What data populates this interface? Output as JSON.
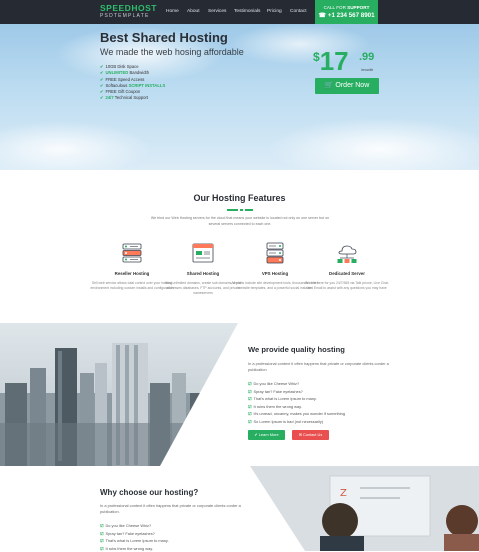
{
  "nav": {
    "logo_main": "SPEEDHOST",
    "logo_sub": "PSDTEMPLATE",
    "items": [
      "Home",
      "About",
      "Services",
      "Testimonials",
      "Pricing",
      "Contact"
    ],
    "call_label_prefix": "CALL FOR ",
    "call_label_strong": "SUPPORT",
    "call_number": "+1 234 567 8901"
  },
  "hero": {
    "title": "Best Shared Hosting",
    "subtitle": "We made the web hosing affordable",
    "features": [
      {
        "before": "",
        "strong": "",
        "after": "10GB Disk Space"
      },
      {
        "before": "",
        "strong": "UNLIMITED",
        "after": " Bandwidth"
      },
      {
        "before": "",
        "strong": "",
        "after": "FREE Speed Access"
      },
      {
        "before": "Softaculous ",
        "strong": "SCRIPT INSTALLS",
        "after": ""
      },
      {
        "before": "",
        "strong": "",
        "after": "FREE Gift Coupon"
      },
      {
        "before": "",
        "strong": "24/7",
        "after": " Technical Support"
      }
    ],
    "price_currency": "$",
    "price_int": "17",
    "price_dec": ".99",
    "price_period": "/month",
    "order_label": "Order Now",
    "accent_color": "#27ae60"
  },
  "hosting": {
    "title": "Our Hosting Features",
    "intro": "We tried our Web Hosting servers for the cloud that means your website is located not only on one server but on several servers connected to each one.",
    "items": [
      {
        "icon": "server-rack-icon",
        "title": "Reseller Hosting",
        "text": "Sell web service allows total control over your hosting environment including custom installs and configuration"
      },
      {
        "icon": "browser-window-icon",
        "title": "Shared Hosting",
        "text": "Host unlimited domains, create sub domains, email addresses databases, FTP accounts, and private nameservers"
      },
      {
        "icon": "server-stack-icon",
        "title": "VPS Hosting",
        "text": "All plans include site development tools, thousands of free website templates, and a powerful social installer"
      },
      {
        "icon": "network-cloud-icon",
        "title": "Dedicated Server",
        "text": "We are here for you 24/7/365 via Talk phone, Live Chat, and Email to assist with any questions you may have"
      }
    ]
  },
  "quality": {
    "title": "We provide quality hosting",
    "text": "In a professional context it often happens that private or corporate clients corder a publication",
    "list": [
      "Do you like Cheese Whiz?",
      "Spray tan? Fake eyelashes?",
      "That's what is Lorem Ipsum to many.",
      "It ruins them the wrong way.",
      "It's unread, uncanny, makes you wonder if something",
      "So Lorem Ipsum is bad (not necessarily)"
    ],
    "learn_more": "Learn More",
    "contact_us": "Contact Us"
  },
  "why": {
    "title": "Why choose our hosting?",
    "text": "In a professional context it often happens that private or corporate clients corder a publication.",
    "list": [
      "Do you like Cheese Whiz?",
      "Spray tan? Fake eyelashes?",
      "That's what is Lorem Ipsum to many.",
      "It rubs them the wrong way."
    ]
  }
}
